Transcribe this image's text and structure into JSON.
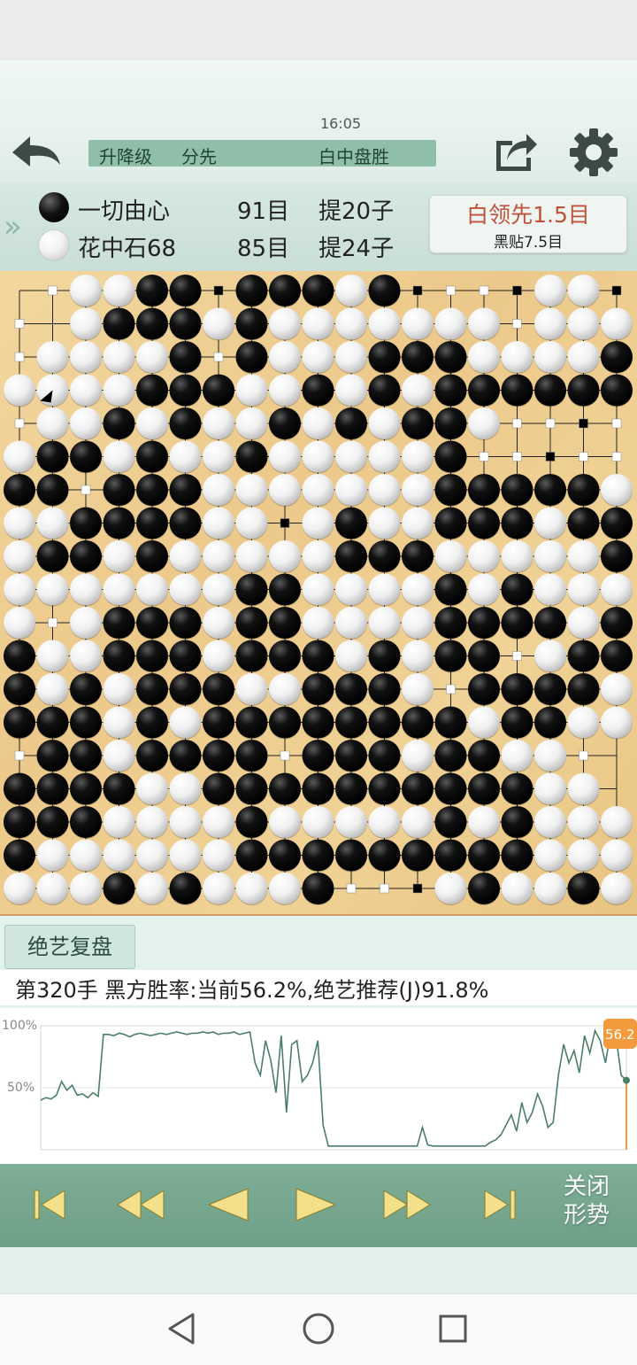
{
  "header": {
    "time": "16:05",
    "mode": "升降级",
    "handicap": "分先",
    "result": "白中盘胜",
    "back_icon": "back-arrow-icon",
    "share_icon": "share-icon",
    "settings_icon": "gear-icon"
  },
  "players": {
    "black": {
      "name": "一切由心",
      "territory": "91目",
      "captures": "提20子"
    },
    "white": {
      "name": "花中石68",
      "territory": "85目",
      "captures": "提24子"
    },
    "lead": "白领先1.5目",
    "komi": "黑贴7.5目"
  },
  "board": {
    "size": 19,
    "rows": [
      "-+wwbb+bbbwb++++ww+w",
      "+-wbbbwbwwwwwww+wwwww",
      "+wwwwb+bwwwbbbwwwwbw",
      "wxwwbbbwwbwbwbbbbbb",
      "+wwbwbwwbwbwbbw++++",
      "wbbwbwwbwwwwwb+++++",
      "bb+bbbwwwwwwwbbbbbw",
      "wwbbbbww+wbwwbbbwbb",
      "wbbwbwwwwwbbbwwwwwb",
      "wwwwwwwbbwwwwbwbwww",
      "w+wbbbwbbwwwwbbbbwb",
      "bwwbbbwbbbwbwbb+wbb",
      "bwbwbbbwwbbbw+bbbbw",
      "bbbwbwbbbbbbbbwbbww",
      "+bbwbbbb+bbbwbbww+",
      "bbbbwwbbbbbbbbbbww",
      "bbbwwwwbwwwwwbwbwww",
      "bwwwwwwbbbbbbbbbwwwJ",
      "wwwbwbwwwb+++wbwwbw"
    ],
    "markers": "territory-squares"
  },
  "review": {
    "button_label": "绝艺复盘",
    "move_info": "第320手  黑方胜率:当前56.2%,绝艺推荐(J)91.8%"
  },
  "trend": {
    "y_top_label": "100%",
    "y_mid_label": "50%",
    "current_label": "56.2",
    "values": [
      40,
      42,
      41,
      44,
      55,
      48,
      52,
      44,
      45,
      42,
      46,
      43,
      93,
      93,
      92,
      94,
      93,
      91,
      93,
      94,
      93,
      92,
      93,
      94,
      93,
      94,
      95,
      94,
      93,
      94,
      94,
      95,
      94,
      95,
      93,
      94,
      94,
      95,
      93,
      94,
      95,
      70,
      60,
      88,
      72,
      46,
      92,
      30,
      85,
      88,
      55,
      60,
      70,
      88,
      20,
      3,
      3,
      3,
      3,
      3,
      3,
      3,
      3,
      3,
      3,
      3,
      3,
      3,
      3,
      3,
      3,
      3,
      3,
      18,
      4,
      3,
      3,
      3,
      3,
      3,
      3,
      3,
      3,
      3,
      3,
      3,
      6,
      8,
      12,
      20,
      28,
      15,
      38,
      22,
      30,
      45,
      35,
      18,
      22,
      60,
      85,
      70,
      80,
      62,
      92,
      78,
      96,
      88,
      70,
      95,
      92,
      60,
      56
    ]
  },
  "controls": {
    "first_icon": "skip-to-start-icon",
    "rewind_icon": "fast-rewind-icon",
    "prev_icon": "step-back-icon",
    "next_icon": "step-forward-icon",
    "fast_forward_icon": "fast-forward-icon",
    "last_icon": "skip-to-end-icon",
    "close_trend_line1": "关闭",
    "close_trend_line2": "形势"
  },
  "navbar": {
    "back_icon": "nav-back-icon",
    "home_icon": "nav-home-icon",
    "recents_icon": "nav-recents-icon"
  }
}
